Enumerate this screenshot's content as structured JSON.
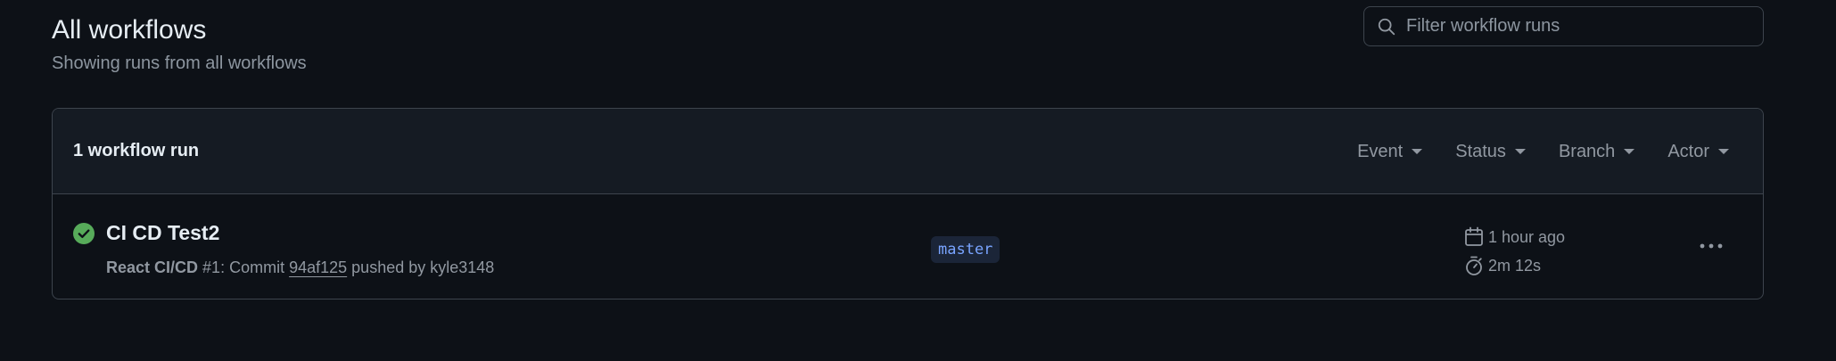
{
  "header": {
    "title": "All workflows",
    "subtitle": "Showing runs from all workflows"
  },
  "search": {
    "placeholder": "Filter workflow runs",
    "value": "",
    "icon": "search-icon"
  },
  "runs_box": {
    "count_label": "1 workflow run",
    "filters": [
      {
        "label": "Event"
      },
      {
        "label": "Status"
      },
      {
        "label": "Branch"
      },
      {
        "label": "Actor"
      }
    ],
    "runs": [
      {
        "status": "success",
        "status_color": "#57ab5a",
        "title": "CI CD Test2",
        "workflow_name": "React CI/CD",
        "run_number": "#1",
        "meta_mid": ": Commit ",
        "commit_sha": "94af125",
        "meta_tail": " pushed by kyle3148",
        "branch": "master",
        "time_ago": "1 hour ago",
        "duration": "2m 12s"
      }
    ]
  },
  "colors": {
    "background": "#0d1117",
    "header_bg": "#151b23",
    "border": "#3d444d",
    "muted_text": "#9198a1",
    "branch_text": "#79a4ff",
    "success": "#57ab5a"
  }
}
